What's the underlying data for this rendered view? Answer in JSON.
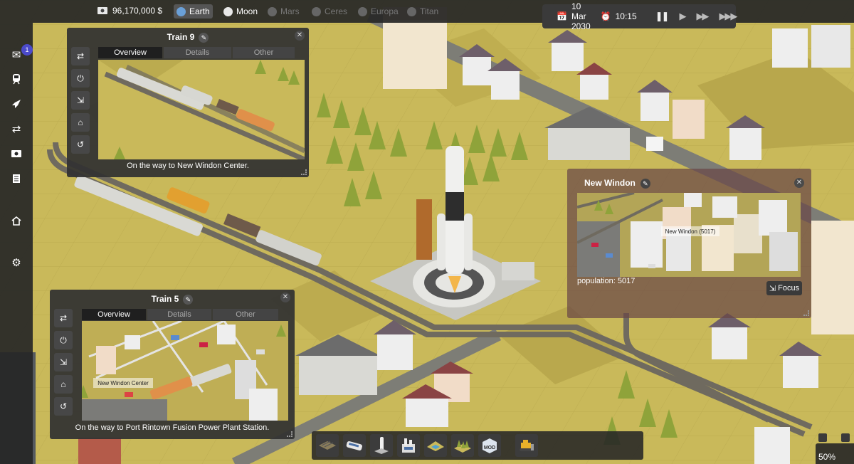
{
  "topbar": {
    "money": "96,170,000 $",
    "money_icon": "cash-icon",
    "planets": [
      {
        "label": "Earth",
        "state": "active",
        "icon": "globe-icon",
        "color": "#6aa0d8"
      },
      {
        "label": "Moon",
        "state": "normal",
        "icon": "moon-icon",
        "color": "#e8e8e8"
      },
      {
        "label": "Mars",
        "state": "locked",
        "icon": "planet-icon",
        "color": "#666666"
      },
      {
        "label": "Ceres",
        "state": "locked",
        "icon": "planet-icon",
        "color": "#666666"
      },
      {
        "label": "Europa",
        "state": "locked",
        "icon": "planet-icon",
        "color": "#666666"
      },
      {
        "label": "Titan",
        "state": "locked",
        "icon": "planet-icon",
        "color": "#666666"
      }
    ]
  },
  "clock": {
    "date": "10 Mar 2030",
    "time": "10:15",
    "controls": [
      "pause-icon",
      "play-icon",
      "fast-forward-icon",
      "fastest-forward-icon"
    ]
  },
  "sidebar": {
    "items": [
      {
        "name": "messages",
        "icon": "mail-icon",
        "badge": "1"
      },
      {
        "name": "trains",
        "icon": "train-icon"
      },
      {
        "name": "rockets",
        "icon": "rocket-icon"
      },
      {
        "name": "routes",
        "icon": "shuffle-icon"
      },
      {
        "name": "finance",
        "icon": "money-icon"
      },
      {
        "name": "ledger",
        "icon": "book-icon"
      },
      {
        "name": "home",
        "icon": "home-icon"
      },
      {
        "name": "settings",
        "icon": "gear-icon"
      }
    ]
  },
  "train9": {
    "title": "Train 9",
    "tabs": [
      "Overview",
      "Details",
      "Other"
    ],
    "active_tab": "Overview",
    "status": "On the way to New Windon Center.",
    "tools": [
      "shuffle-icon",
      "power-icon",
      "collapse-icon",
      "depot-icon",
      "undo-icon"
    ]
  },
  "train5": {
    "title": "Train 5",
    "tabs": [
      "Overview",
      "Details",
      "Other"
    ],
    "active_tab": "Overview",
    "status": "On the way to Port Rintown Fusion Power Plant Station.",
    "preview_label": "New Windon Center",
    "tools": [
      "shuffle-icon",
      "power-icon",
      "collapse-icon",
      "depot-icon",
      "undo-icon"
    ]
  },
  "city": {
    "name": "New Windon",
    "population": "population: 5017",
    "preview_label": "New Windon (5017)",
    "focus_label": "Focus"
  },
  "buildbar": {
    "items": [
      "rail-track-tool",
      "train-tool",
      "rocket-launch-tool",
      "power-plant-tool",
      "terrain-tool",
      "trees-tool",
      "mod-tool",
      "bulldozer-tool"
    ],
    "mod_label": "MOD"
  },
  "zoom": {
    "level": "50%"
  },
  "colors": {
    "ground": "#c9b95a",
    "ui_dark": "#262626",
    "accent_badge": "#4b4acb",
    "city_overlay": "#694646"
  }
}
